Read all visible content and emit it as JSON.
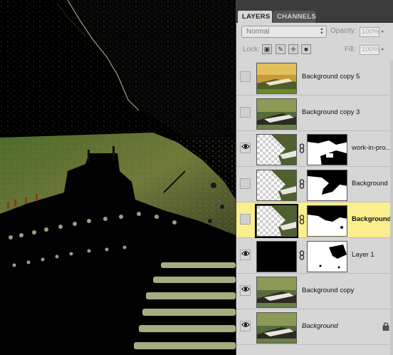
{
  "panel": {
    "tabs": [
      {
        "label": "LAYERS",
        "active": true
      },
      {
        "label": "CHANNELS",
        "active": false
      }
    ],
    "blend_mode": "Normal",
    "opacity_label": "Opacity:",
    "opacity_value": "100%",
    "lock_label": "Lock:",
    "fill_label": "Fill:",
    "fill_value": "100%",
    "lock_icons": [
      "lock-transparent-icon",
      "lock-paint-icon",
      "lock-move-icon",
      "lock-all-icon"
    ]
  },
  "layers": [
    {
      "name": "Background copy 5",
      "visible": false,
      "has_mask": false,
      "thumb": "photo-warm"
    },
    {
      "name": "Background copy 3",
      "visible": false,
      "has_mask": false,
      "thumb": "photo"
    },
    {
      "name": "work-in-pro...",
      "visible": true,
      "has_mask": true,
      "thumb": "checker-photo"
    },
    {
      "name": "Background ...",
      "visible": false,
      "has_mask": true,
      "thumb": "checker-photo"
    },
    {
      "name": "Background...",
      "visible": false,
      "has_mask": true,
      "thumb": "checker-photo",
      "selected": true
    },
    {
      "name": "Layer 1",
      "visible": true,
      "has_mask": true,
      "thumb": "black"
    },
    {
      "name": "Background copy",
      "visible": true,
      "has_mask": false,
      "thumb": "photo"
    },
    {
      "name": "Background",
      "visible": true,
      "has_mask": false,
      "thumb": "photo",
      "locked": true
    }
  ],
  "colors": {
    "selected_row": "#fbee8d",
    "panel_bg": "#d6d6d6",
    "canvas_bg": "#000000"
  }
}
